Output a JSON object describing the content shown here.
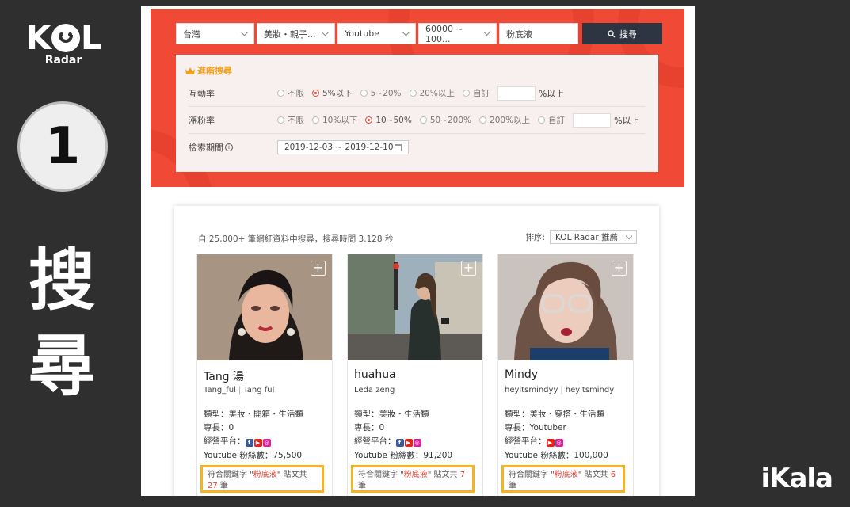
{
  "brand": {
    "logo_main_left": "K",
    "logo_main_right": "L",
    "logo_sub": "Radar",
    "logo_icon": "smiley-icon"
  },
  "step": {
    "number": "1",
    "title_line1": "搜",
    "title_line2": "尋"
  },
  "footer": {
    "ikala": "iKala"
  },
  "search": {
    "country": "台灣",
    "category": "美妝・親子...",
    "platform": "Youtube",
    "followers": "60000 ~ 100...",
    "keyword": "粉底液",
    "button_label": "搜尋",
    "button_icon": "search-icon"
  },
  "advanced": {
    "title": "進階搜尋",
    "title_icon": "crown-icon",
    "engagement": {
      "label": "互動率",
      "options": [
        "不限",
        "5%以下",
        "5~20%",
        "20%以上",
        "自訂"
      ],
      "selected": 1,
      "suffix": "%以上"
    },
    "growth": {
      "label": "漲粉率",
      "options": [
        "不限",
        "10%以下",
        "10~50%",
        "50~200%",
        "200%以上",
        "自訂"
      ],
      "selected": 2,
      "suffix": "%以上"
    },
    "period": {
      "label": "檢索期間",
      "value": "2019-12-03  ~  2019-12-10"
    }
  },
  "results": {
    "summary": "自 25,000+ 筆網紅資料中搜尋，搜尋時間 3.128 秒",
    "sort_label": "排序:",
    "sort_value": "KOL Radar 推薦",
    "cards": [
      {
        "name": "Tang 湯",
        "handle1": "Tang_ful",
        "handle2": "Tang ful",
        "type": "類型：美妝・開箱・生活類",
        "specialty": "專長：0",
        "platform_label": "經營平台：",
        "platforms": [
          "fb",
          "yt",
          "ig"
        ],
        "stats": "Youtube  粉絲數：75,500",
        "kw_prefix": "符合關鍵字 \"",
        "kw_word": "粉底液",
        "kw_mid": "\" 貼文共 ",
        "kw_count": "27",
        "kw_suffix": " 筆"
      },
      {
        "name": "huahua",
        "handle1": "Leda zeng",
        "handle2": "",
        "type": "類型：美妝・生活類",
        "specialty": "專長：0",
        "platform_label": "經營平台：",
        "platforms": [
          "fb",
          "yt",
          "ig"
        ],
        "stats": "Youtube  粉絲數：91,200",
        "kw_prefix": "符合關鍵字 \"",
        "kw_word": "粉底液",
        "kw_mid": "\" 貼文共 ",
        "kw_count": "7",
        "kw_suffix": " 筆"
      },
      {
        "name": "Mindy",
        "handle1": "heyitsmindyy",
        "handle2": "heyitsmindy",
        "type": "類型：美妝・穿搭・生活類",
        "specialty": "專長：Youtuber",
        "platform_label": "經營平台：",
        "platforms": [
          "yt",
          "ig"
        ],
        "stats": "Youtube  粉絲數：100,000",
        "kw_prefix": "符合關鍵字 \"",
        "kw_word": "粉底液",
        "kw_mid": "\" 貼文共 ",
        "kw_count": "6",
        "kw_suffix": " 筆"
      }
    ]
  },
  "colors": {
    "accent": "#f04a36",
    "dark": "#2f2f2f",
    "highlight_border": "#f5b321",
    "search_button": "#2e3542"
  }
}
